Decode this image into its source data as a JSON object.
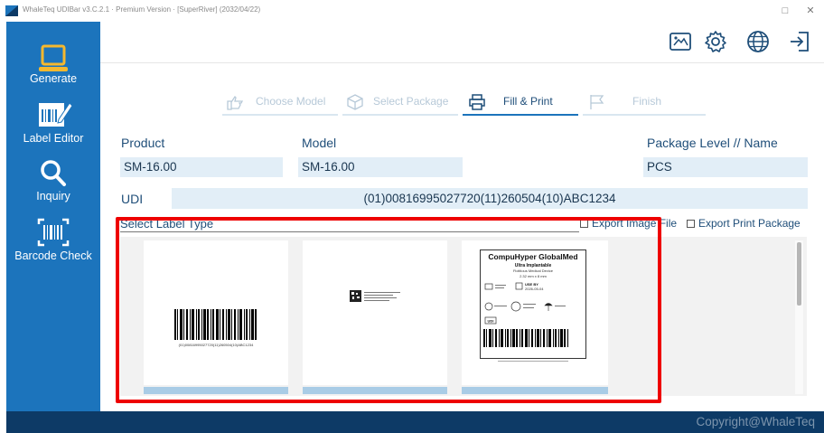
{
  "window": {
    "title": "WhaleTeq UDIBar v3.C.2.1 · Premium Version · [SuperRiver] (2032/04/22)",
    "minimize_glyph": "□",
    "close_glyph": "✕"
  },
  "sidebar": {
    "items": [
      {
        "label": "Generate",
        "icon": "laptop-icon"
      },
      {
        "label": "Label Editor",
        "icon": "label-edit-icon"
      },
      {
        "label": "Inquiry",
        "icon": "search-icon"
      },
      {
        "label": "Barcode Check",
        "icon": "barcode-scan-icon"
      }
    ]
  },
  "toolbar": {
    "icons": [
      "image-edit-icon",
      "gear-icon",
      "globe-icon",
      "logout-icon"
    ]
  },
  "stepper": {
    "steps": [
      {
        "label": "Choose Model",
        "state": "inactive"
      },
      {
        "label": "Select Package",
        "state": "inactive"
      },
      {
        "label": "Fill & Print",
        "state": "active"
      },
      {
        "label": "Finish",
        "state": "inactive"
      }
    ]
  },
  "form": {
    "product_label": "Product",
    "product_value": "SM-16.00",
    "model_label": "Model",
    "model_value": "SM-16.00",
    "package_label": "Package Level // Name",
    "package_value": "PCS",
    "udi_label": "UDI",
    "udi_value": "(01)00816995027720(11)260504(10)ABC1234"
  },
  "label_select": {
    "title": "Select Label Type",
    "export_image": "Export Image File",
    "export_print": "Export Print Package"
  },
  "label_preview": {
    "brand": "CompuHyper GlobalMed",
    "product": "Ultra Implantable",
    "description": "Fictitious Medical Device",
    "spec": "2.32 mm x 8 mm",
    "use_by": "USE BY",
    "use_by_date": "2026-05-04",
    "udi_tag": "UDI",
    "barcode_text": "(01)00816995027720(11)260504(10)ABC1234"
  },
  "footer": {
    "copyright": "Copyright@WhaleTeq"
  },
  "colors": {
    "sidebar": "#1c74bc",
    "footer": "#0d3a66",
    "field_bg": "#e2eef7",
    "highlight": "#ee0000",
    "card_bar": "#a9cce6"
  }
}
